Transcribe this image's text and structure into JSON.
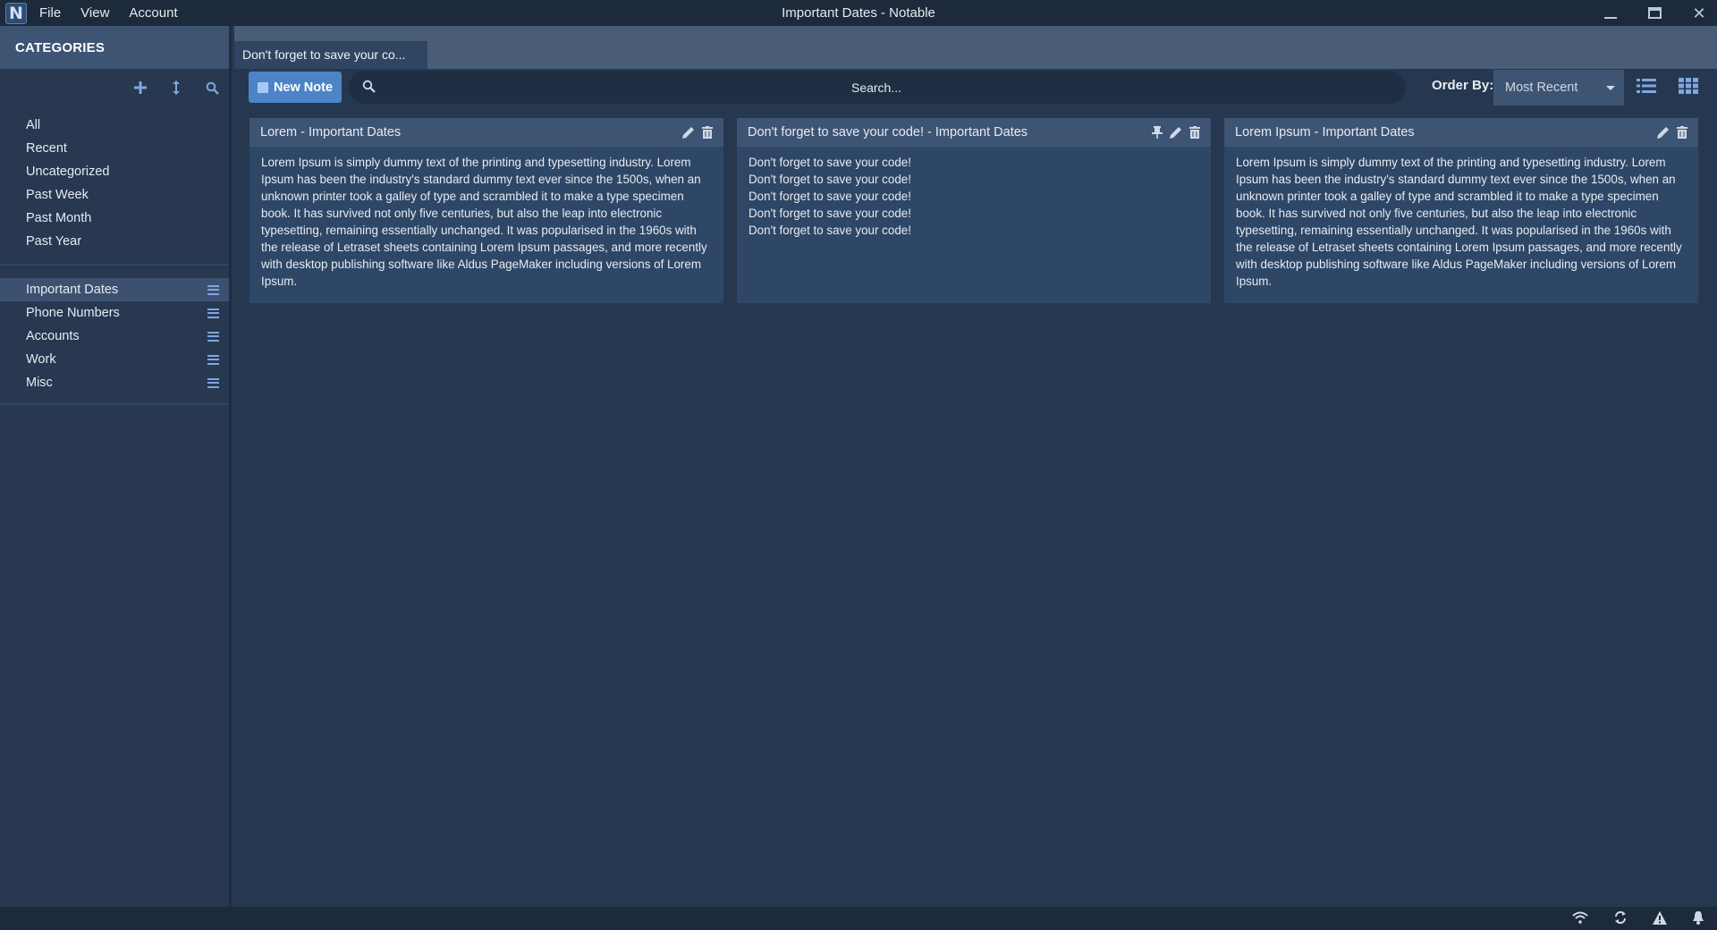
{
  "window": {
    "title": "Important Dates - Notable",
    "menu": [
      "File",
      "View",
      "Account"
    ],
    "logo_letter": "N"
  },
  "sidebar": {
    "header": "CATEGORIES",
    "categories": [
      "All",
      "Recent",
      "Uncategorized",
      "Past Week",
      "Past Month",
      "Past Year"
    ],
    "notebooks": [
      {
        "label": "Important Dates",
        "active": true
      },
      {
        "label": "Phone Numbers",
        "active": false
      },
      {
        "label": "Accounts",
        "active": false
      },
      {
        "label": "Work",
        "active": false
      },
      {
        "label": "Misc",
        "active": false
      }
    ]
  },
  "tabs": [
    {
      "label": "Don't forget to save your co..."
    }
  ],
  "toolbar": {
    "new_note_label": "New Note",
    "search_placeholder": "Search...",
    "order_by_label": "Order By:",
    "order_by_value": "Most Recent"
  },
  "notes": [
    {
      "title": "Lorem  -  Important Dates",
      "pinned": false,
      "body": "Lorem Ipsum is simply dummy text of the printing and typesetting industry. Lorem Ipsum has been the industry's standard dummy text ever since the 1500s, when an unknown printer took a galley of type and scrambled it to make a type specimen book. It has survived not only five centuries, but also the leap into electronic typesetting, remaining essentially unchanged. It was popularised in the 1960s with the release of Letraset sheets containing Lorem Ipsum passages, and more recently with desktop publishing software like Aldus PageMaker including versions of Lorem Ipsum."
    },
    {
      "title": "Don't forget to save your code!  -  Important Dates",
      "pinned": true,
      "lines": [
        "Don't forget to save your code!",
        "Don't forget to save your code!",
        "Don't forget to save your code!",
        "Don't forget to save your code!",
        "Don't forget to save your code!"
      ]
    },
    {
      "title": "Lorem Ipsum  -  Important Dates",
      "pinned": false,
      "body": "Lorem Ipsum is simply dummy text of the printing and typesetting industry. Lorem Ipsum has been the industry's standard dummy text ever since the 1500s, when an unknown printer took a galley of type and scrambled it to make a type specimen book. It has survived not only five centuries, but also the leap into electronic typesetting, remaining essentially unchanged. It was popularised in the 1960s with the release of Letraset sheets containing Lorem Ipsum passages, and more recently with desktop publishing software like Aldus PageMaker including versions of Lorem Ipsum."
    }
  ],
  "colors": {
    "accent": "#4d84c7",
    "background": "#263750",
    "panel": "#3e5473",
    "card": "#2f4766"
  },
  "icons": {
    "status": [
      "wifi-icon",
      "sync-icon",
      "warning-icon",
      "bell-icon"
    ]
  }
}
